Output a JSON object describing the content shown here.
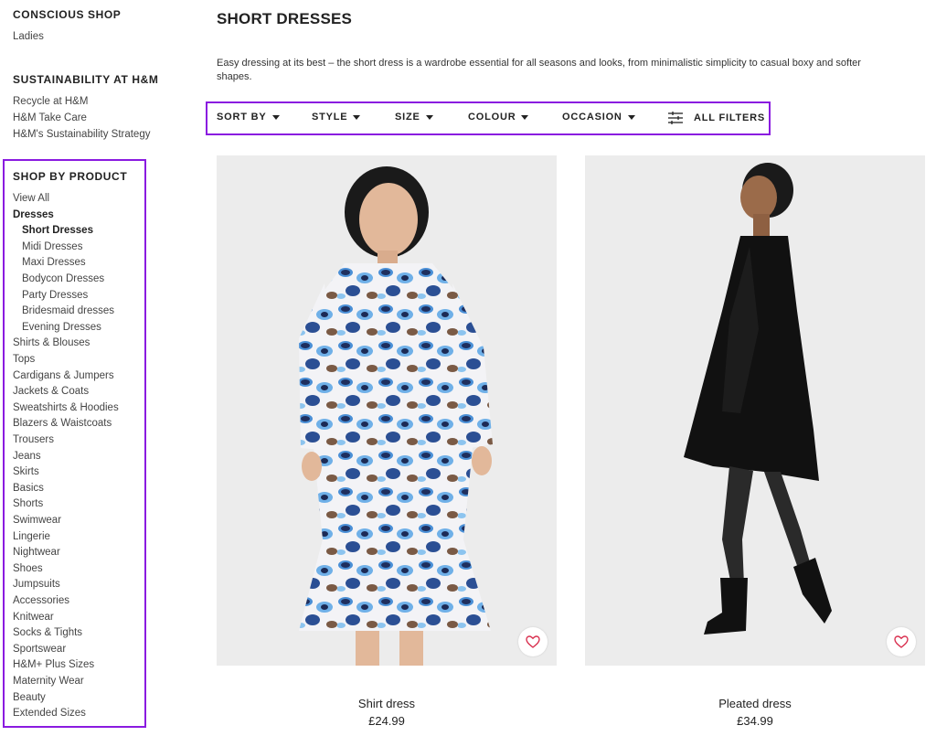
{
  "sidebar": {
    "conscious": {
      "heading": "CONSCIOUS SHOP",
      "links": [
        "Ladies"
      ]
    },
    "sustainability": {
      "heading": "SUSTAINABILITY AT H&M",
      "links": [
        "Recycle at H&M",
        "H&M Take Care",
        "H&M's Sustainability Strategy"
      ]
    },
    "shop_by_product": {
      "heading": "SHOP BY PRODUCT",
      "items": [
        {
          "label": "View All"
        },
        {
          "label": "Dresses"
        },
        {
          "label": "Short Dresses"
        },
        {
          "label": "Midi Dresses"
        },
        {
          "label": "Maxi Dresses"
        },
        {
          "label": "Bodycon Dresses"
        },
        {
          "label": "Party Dresses"
        },
        {
          "label": "Bridesmaid dresses"
        },
        {
          "label": "Evening Dresses"
        },
        {
          "label": "Shirts & Blouses"
        },
        {
          "label": "Tops"
        },
        {
          "label": "Cardigans & Jumpers"
        },
        {
          "label": "Jackets & Coats"
        },
        {
          "label": "Sweatshirts & Hoodies"
        },
        {
          "label": "Blazers & Waistcoats"
        },
        {
          "label": "Trousers"
        },
        {
          "label": "Jeans"
        },
        {
          "label": "Skirts"
        },
        {
          "label": "Basics"
        },
        {
          "label": "Shorts"
        },
        {
          "label": "Swimwear"
        },
        {
          "label": "Lingerie"
        },
        {
          "label": "Nightwear"
        },
        {
          "label": "Shoes"
        },
        {
          "label": "Jumpsuits"
        },
        {
          "label": "Accessories"
        },
        {
          "label": "Knitwear"
        },
        {
          "label": "Socks & Tights"
        },
        {
          "label": "Sportswear"
        },
        {
          "label": "H&M+ Plus Sizes"
        },
        {
          "label": "Maternity Wear"
        },
        {
          "label": "Beauty"
        },
        {
          "label": "Extended Sizes"
        }
      ]
    }
  },
  "main": {
    "title": "SHORT DRESSES",
    "description": "Easy dressing at its best – the short dress is a wardrobe essential for all seasons and looks, from minimalistic simplicity to casual boxy and softer shapes.",
    "filters": [
      "SORT BY",
      "STYLE",
      "SIZE",
      "COLOUR",
      "OCCASION"
    ],
    "all_filters": "ALL FILTERS",
    "products": [
      {
        "name": "Shirt dress",
        "price": "£24.99"
      },
      {
        "name": "Pleated dress",
        "price": "£34.99"
      }
    ]
  },
  "colors": {
    "highlight": "#8a1be0",
    "heart": "#d9304f"
  }
}
